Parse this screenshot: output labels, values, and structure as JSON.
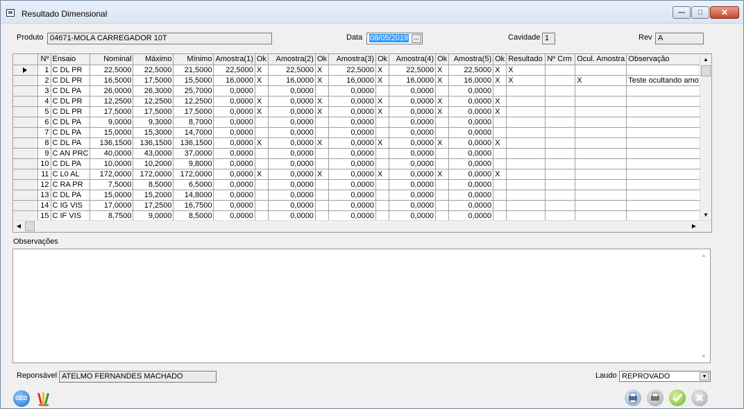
{
  "window": {
    "title": "Resultado Dimensional"
  },
  "header": {
    "produto_label": "Produto",
    "produto_value": "04671-MOLA CARREGADOR 10T",
    "data_label": "Data",
    "data_value": "08/05/2019",
    "cavidade_label": "Cavidade",
    "cavidade_value": "1",
    "rev_label": "Rev",
    "rev_value": "A"
  },
  "grid": {
    "columns": [
      "Nº",
      "Ensaio",
      "Nominal",
      "Máximo",
      "Mínimo",
      "Amostra(1)",
      "Ok",
      "Amostra(2)",
      "Ok",
      "Amostra(3)",
      "Ok",
      "Amostra(4)",
      "Ok",
      "Amostra(5)",
      "Ok",
      "Resultado",
      "Nº Crm",
      "Ocul. Amostra",
      "Observação"
    ],
    "rows": [
      [
        "1",
        "C DL PR",
        "22,5000",
        "22,5000",
        "21,5000",
        "22,5000",
        "X",
        "22,5000",
        "X",
        "22,5000",
        "X",
        "22,5000",
        "X",
        "22,5000",
        "X",
        "X",
        "",
        "",
        ""
      ],
      [
        "2",
        "C DL PR",
        "16,5000",
        "17,5000",
        "15,5000",
        "16,0000",
        "X",
        "16,0000",
        "X",
        "16,0000",
        "X",
        "16,0000",
        "X",
        "16,0000",
        "X",
        "X",
        "",
        "X",
        "Teste ocultando amo"
      ],
      [
        "3",
        "C DL PA",
        "26,0000",
        "26,3000",
        "25,7000",
        "0,0000",
        "",
        "0,0000",
        "",
        "0,0000",
        "",
        "0,0000",
        "",
        "0,0000",
        "",
        "",
        "",
        "",
        ""
      ],
      [
        "4",
        "C DL PR",
        "12,2500",
        "12,2500",
        "12,2500",
        "0,0000",
        "X",
        "0,0000",
        "X",
        "0,0000",
        "X",
        "0,0000",
        "X",
        "0,0000",
        "X",
        "",
        "",
        "",
        ""
      ],
      [
        "5",
        "C DL PR",
        "17,5000",
        "17,5000",
        "17,5000",
        "0,0000",
        "X",
        "0,0000",
        "X",
        "0,0000",
        "X",
        "0,0000",
        "X",
        "0,0000",
        "X",
        "",
        "",
        "",
        ""
      ],
      [
        "6",
        "C DL PA",
        "9,0000",
        "9,3000",
        "8,7000",
        "0,0000",
        "",
        "0,0000",
        "",
        "0,0000",
        "",
        "0,0000",
        "",
        "0,0000",
        "",
        "",
        "",
        "",
        ""
      ],
      [
        "7",
        "C DL PA",
        "15,0000",
        "15,3000",
        "14,7000",
        "0,0000",
        "",
        "0,0000",
        "",
        "0,0000",
        "",
        "0,0000",
        "",
        "0,0000",
        "",
        "",
        "",
        "",
        ""
      ],
      [
        "8",
        "C DL PA",
        "136,1500",
        "136,1500",
        "136,1500",
        "0,0000",
        "X",
        "0,0000",
        "X",
        "0,0000",
        "X",
        "0,0000",
        "X",
        "0,0000",
        "X",
        "",
        "",
        "",
        ""
      ],
      [
        "9",
        "C AN PRC",
        "40,0000",
        "43,0000",
        "37,0000",
        "0,0000",
        "",
        "0,0000",
        "",
        "0,0000",
        "",
        "0,0000",
        "",
        "0,0000",
        "",
        "",
        "",
        "",
        ""
      ],
      [
        "10",
        "C DL PA",
        "10,0000",
        "10,2000",
        "9,8000",
        "0,0000",
        "",
        "0,0000",
        "",
        "0,0000",
        "",
        "0,0000",
        "",
        "0,0000",
        "",
        "",
        "",
        "",
        ""
      ],
      [
        "11",
        "C L0 AL",
        "172,0000",
        "172,0000",
        "172,0000",
        "0,0000",
        "X",
        "0,0000",
        "X",
        "0,0000",
        "X",
        "0,0000",
        "X",
        "0,0000",
        "X",
        "",
        "",
        "",
        ""
      ],
      [
        "12",
        "C RA PR",
        "7,5000",
        "8,5000",
        "6,5000",
        "0,0000",
        "",
        "0,0000",
        "",
        "0,0000",
        "",
        "0,0000",
        "",
        "0,0000",
        "",
        "",
        "",
        "",
        ""
      ],
      [
        "13",
        "C DL PA",
        "15,0000",
        "15,2000",
        "14,8000",
        "0,0000",
        "",
        "0,0000",
        "",
        "0,0000",
        "",
        "0,0000",
        "",
        "0,0000",
        "",
        "",
        "",
        "",
        ""
      ],
      [
        "14",
        "C IG VIS",
        "17,0000",
        "17,2500",
        "16,7500",
        "0,0000",
        "",
        "0,0000",
        "",
        "0,0000",
        "",
        "0,0000",
        "",
        "0,0000",
        "",
        "",
        "",
        "",
        ""
      ],
      [
        "15",
        "C IF VIS",
        "8,7500",
        "9,0000",
        "8,5000",
        "0,0000",
        "",
        "0,0000",
        "",
        "0,0000",
        "",
        "0,0000",
        "",
        "0,0000",
        "",
        "",
        "",
        "",
        ""
      ]
    ]
  },
  "observacoes_label": "Observações",
  "footer": {
    "responsavel_label": "Reponsável",
    "responsavel_value": "ATELMO FERNANDES MACHADO",
    "laudo_label": "Laudo",
    "laudo_value": "REPROVADO",
    "ged_label": "GED"
  }
}
